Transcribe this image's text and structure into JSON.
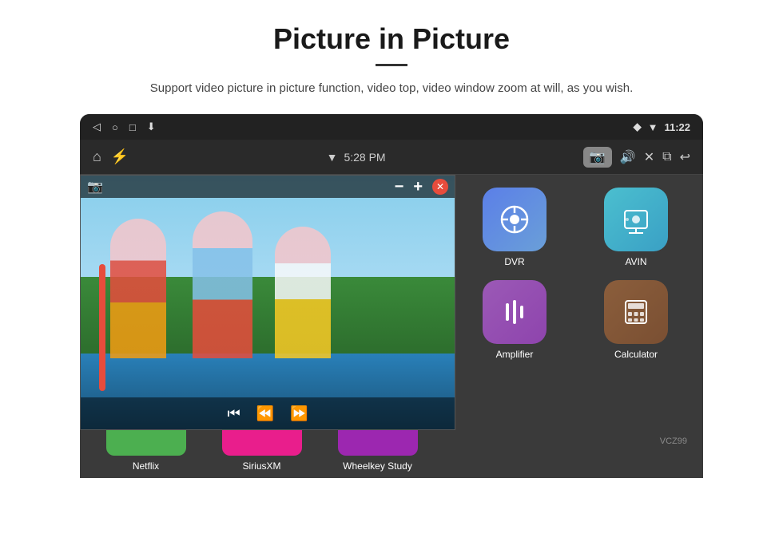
{
  "header": {
    "title": "Picture in Picture",
    "description": "Support video picture in picture function, video top, video window zoom at will, as you wish."
  },
  "statusBar": {
    "time": "11:22",
    "icons": [
      "back",
      "home",
      "square",
      "download"
    ]
  },
  "toolbar": {
    "time": "5:28 PM",
    "icons": [
      "home",
      "usb",
      "wifi",
      "camera",
      "volume",
      "close",
      "pip",
      "back"
    ]
  },
  "pip": {
    "headerIcon": "📷",
    "minusLabel": "−",
    "plusLabel": "+",
    "closeLabel": "✕",
    "prevLabel": "⏮",
    "playLabel": "⏪",
    "nextLabel": "⏩"
  },
  "apps": {
    "grid": [
      {
        "id": "dvr",
        "label": "DVR",
        "colorClass": "icon-dvr",
        "icon": "dvr"
      },
      {
        "id": "avin",
        "label": "AVIN",
        "colorClass": "icon-avin",
        "icon": "avin"
      },
      {
        "id": "amplifier",
        "label": "Amplifier",
        "colorClass": "icon-amplifier",
        "icon": "amplifier"
      },
      {
        "id": "calculator",
        "label": "Calculator",
        "colorClass": "icon-calculator",
        "icon": "calculator"
      }
    ],
    "bottom": [
      {
        "id": "netflix",
        "label": "Netflix",
        "colorClass": "btn-green"
      },
      {
        "id": "siriusxm",
        "label": "SiriusXM",
        "colorClass": "btn-pink"
      },
      {
        "id": "wheelkey",
        "label": "Wheelkey Study",
        "colorClass": "btn-purple"
      }
    ]
  },
  "watermark": "VCZ99"
}
